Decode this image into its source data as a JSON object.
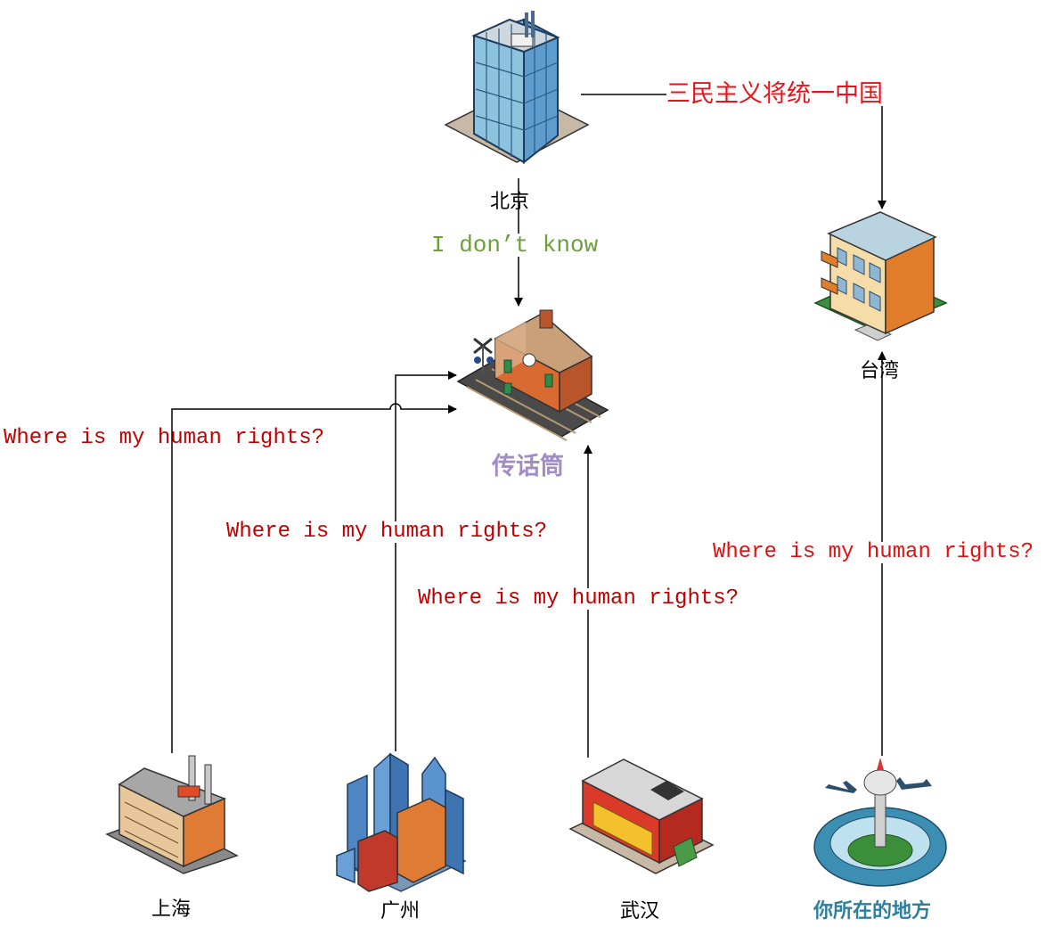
{
  "colors": {
    "line": "#000000",
    "slogan": "#e8141b",
    "reply": "#6aa13a",
    "question": "#c00000",
    "question_bright": "#e01010",
    "hub_label": "#a18cc4",
    "you_label": "#2e7f9c"
  },
  "nodes": {
    "beijing": {
      "label": "北京",
      "icon": "office-tower-icon"
    },
    "taiwan": {
      "label": "台湾",
      "icon": "apartment-building-icon"
    },
    "hub": {
      "label": "传话筒",
      "icon": "train-station-icon"
    },
    "shanghai": {
      "label": "上海",
      "icon": "factory-icon"
    },
    "guangzhou": {
      "label": "广州",
      "icon": "city-skyline-icon"
    },
    "wuhan": {
      "label": "武汉",
      "icon": "shop-building-icon"
    },
    "you": {
      "label": "你所在的地方",
      "icon": "airport-tower-icon"
    }
  },
  "edges": {
    "beijing_taiwan": "三民主义将统一中国",
    "beijing_hub": "I don’t know",
    "shanghai_hub": "Where is my human rights?",
    "guangzhou_hub": "Where is my human rights?",
    "wuhan_hub": "Where is my human rights?",
    "you_taiwan": "Where is my human rights?"
  }
}
